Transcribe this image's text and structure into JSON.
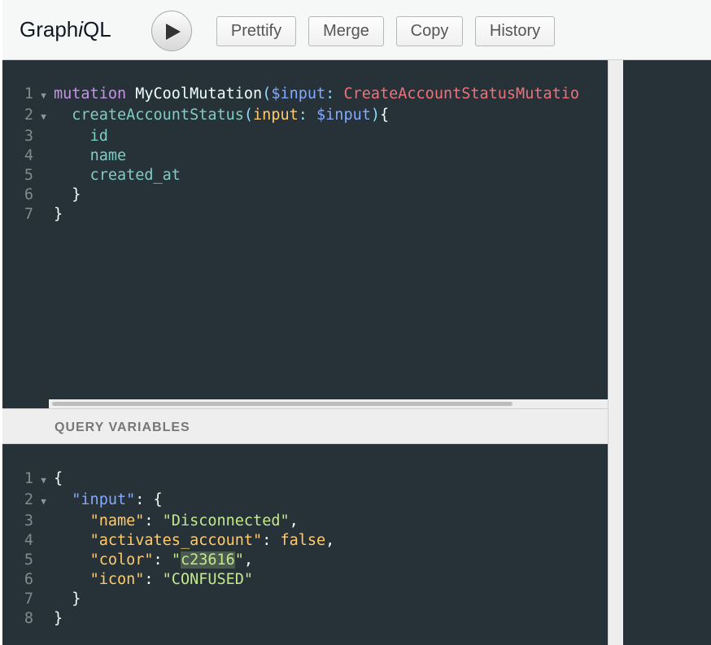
{
  "app": {
    "title_pre": "Graph",
    "title_i": "i",
    "title_post": "QL"
  },
  "toolbar": {
    "prettify": "Prettify",
    "merge": "Merge",
    "copy": "Copy",
    "history": "History"
  },
  "query_editor": {
    "lines": [
      {
        "n": "1",
        "fold": true,
        "tokens": [
          [
            "kw",
            "mutation"
          ],
          [
            "def",
            " MyCoolMutation"
          ],
          [
            "punc",
            "("
          ],
          [
            "var",
            "$input"
          ],
          [
            "punc",
            ": "
          ],
          [
            "type",
            "CreateAccountStatusMutatio"
          ]
        ]
      },
      {
        "n": "2",
        "fold": true,
        "tokens": [
          [
            "def",
            "  "
          ],
          [
            "field",
            "createAccountStatus"
          ],
          [
            "punc",
            "("
          ],
          [
            "arg",
            "input"
          ],
          [
            "punc",
            ": "
          ],
          [
            "var",
            "$input"
          ],
          [
            "punc",
            ")"
          ],
          [
            "brace",
            "{"
          ]
        ]
      },
      {
        "n": "3",
        "fold": false,
        "tokens": [
          [
            "def",
            "    "
          ],
          [
            "field",
            "id"
          ]
        ]
      },
      {
        "n": "4",
        "fold": false,
        "tokens": [
          [
            "def",
            "    "
          ],
          [
            "field",
            "name"
          ]
        ]
      },
      {
        "n": "5",
        "fold": false,
        "tokens": [
          [
            "def",
            "    "
          ],
          [
            "field",
            "created_at"
          ]
        ]
      },
      {
        "n": "6",
        "fold": false,
        "tokens": [
          [
            "def",
            "  "
          ],
          [
            "brace",
            "}"
          ]
        ]
      },
      {
        "n": "7",
        "fold": false,
        "tokens": [
          [
            "brace",
            "}"
          ]
        ]
      }
    ]
  },
  "variables": {
    "header": "QUERY VARIABLES",
    "lines": [
      {
        "n": "1",
        "fold": true,
        "tokens": [
          [
            "white",
            "{"
          ]
        ]
      },
      {
        "n": "2",
        "fold": true,
        "tokens": [
          [
            "white",
            "  "
          ],
          [
            "key",
            "\"input\""
          ],
          [
            "white",
            ": {"
          ]
        ]
      },
      {
        "n": "3",
        "fold": false,
        "tokens": [
          [
            "white",
            "    "
          ],
          [
            "arg",
            "\"name\""
          ],
          [
            "white",
            ": "
          ],
          [
            "str",
            "\"Disconnected\""
          ],
          [
            "white",
            ","
          ]
        ]
      },
      {
        "n": "4",
        "fold": false,
        "tokens": [
          [
            "white",
            "    "
          ],
          [
            "arg",
            "\"activates_account\""
          ],
          [
            "white",
            ": "
          ],
          [
            "arg",
            "false"
          ],
          [
            "white",
            ","
          ]
        ]
      },
      {
        "n": "5",
        "fold": false,
        "tokens": [
          [
            "white",
            "    "
          ],
          [
            "arg",
            "\"color\""
          ],
          [
            "white",
            ": "
          ],
          [
            "str",
            "\""
          ],
          [
            "str hl",
            "c23616"
          ],
          [
            "str",
            "\""
          ],
          [
            "white",
            ","
          ]
        ]
      },
      {
        "n": "6",
        "fold": false,
        "tokens": [
          [
            "white",
            "    "
          ],
          [
            "arg",
            "\"icon\""
          ],
          [
            "white",
            ": "
          ],
          [
            "str",
            "\"CONFUSED\""
          ]
        ]
      },
      {
        "n": "7",
        "fold": false,
        "tokens": [
          [
            "white",
            "  }"
          ]
        ]
      },
      {
        "n": "8",
        "fold": false,
        "tokens": [
          [
            "white",
            "}"
          ]
        ]
      }
    ]
  },
  "icons": {
    "run": "play-icon",
    "fold": "fold-arrow-icon"
  }
}
